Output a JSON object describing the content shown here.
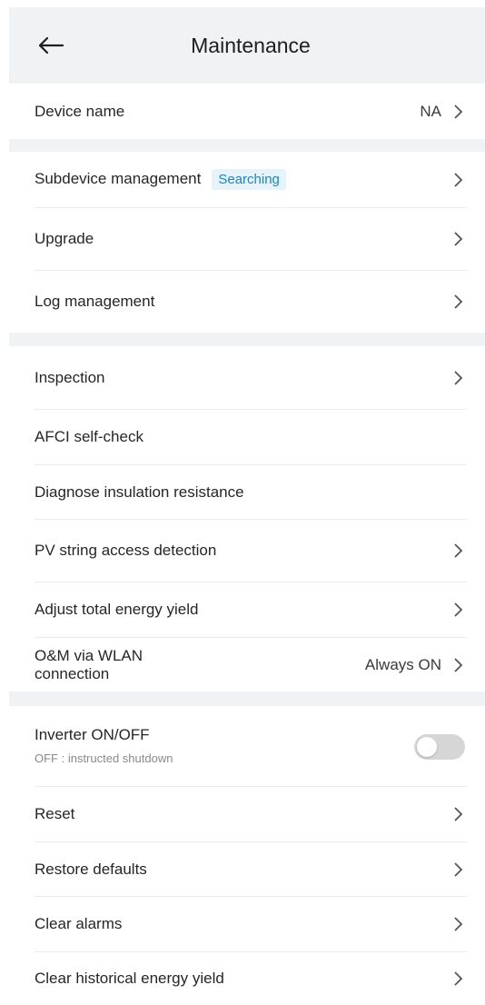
{
  "header": {
    "title": "Maintenance",
    "back_icon": "arrow-left-icon"
  },
  "rows": {
    "device_name": {
      "label": "Device name",
      "value": "NA"
    },
    "subdevice": {
      "label": "Subdevice management",
      "badge": "Searching"
    },
    "upgrade": {
      "label": "Upgrade"
    },
    "log": {
      "label": "Log management"
    },
    "inspection": {
      "label": "Inspection"
    },
    "afci": {
      "label": "AFCI self-check"
    },
    "insulation": {
      "label": "Diagnose insulation resistance"
    },
    "pv_string": {
      "label": "PV string access detection"
    },
    "adjust_energy": {
      "label": "Adjust total energy yield"
    },
    "wlan": {
      "label_line1": "O&M via WLAN",
      "label_line2": "connection",
      "value": "Always ON"
    },
    "inverter": {
      "label": "Inverter ON/OFF",
      "sub": "OFF : instructed shutdown",
      "toggle_on": false
    },
    "reset": {
      "label": "Reset"
    },
    "restore": {
      "label": "Restore defaults"
    },
    "clear_alarms": {
      "label": "Clear alarms"
    },
    "clear_history": {
      "label": "Clear historical energy yield"
    }
  },
  "colors": {
    "band": "#f1f2f4",
    "badge_bg": "#e6f3fa",
    "badge_text": "#1a86c6",
    "toggle_off": "#d6d6d6"
  }
}
